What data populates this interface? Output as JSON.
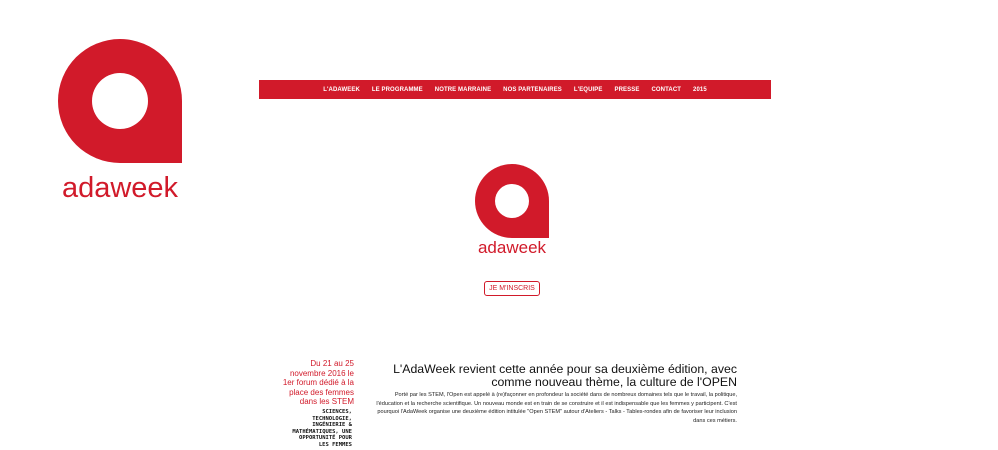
{
  "brand": {
    "name": "adaweek",
    "color": "#d11a2a"
  },
  "nav": {
    "items": [
      {
        "label": "L'ADAWEEK"
      },
      {
        "label": "LE PROGRAMME"
      },
      {
        "label": "NOTRE MARRAINE"
      },
      {
        "label": "NOS PARTENAIRES"
      },
      {
        "label": "L'EQUIPE"
      },
      {
        "label": "PRESSE"
      },
      {
        "label": "CONTACT"
      },
      {
        "label": "2015"
      }
    ]
  },
  "cta": {
    "label": "JE M'INSCRIS"
  },
  "sidebar": {
    "date_text": "Du 21 au 25 novembre 2016 le 1er forum dédié à la place des femmes dans les STEM",
    "stem_text": "SCIENCES, TECHNOLOGIE, INGÉNIERIE & MATHÉMATIQUES, UNE OPPORTUNITÉ POUR LES FEMMES"
  },
  "main": {
    "headline": "L'AdaWeek revient cette année pour sa deuxième édition, avec comme nouveau thème, la culture de l'OPEN",
    "body": "Porté par les STEM, l'Open est appelé à (re)façonner en profondeur la société dans de nombreux domaines tels que le travail, la politique, l'éducation et la recherche scientifique. Un nouveau monde est en train de se construire et il est indispensable que les femmes y participent. C'est pourquoi l'AdaWeek organise une deuxième édition intitulée \"Open STEM\" autour d'Ateliers - Talks - Tables-rondes afin de favoriser leur inclusion dans ces métiers."
  }
}
